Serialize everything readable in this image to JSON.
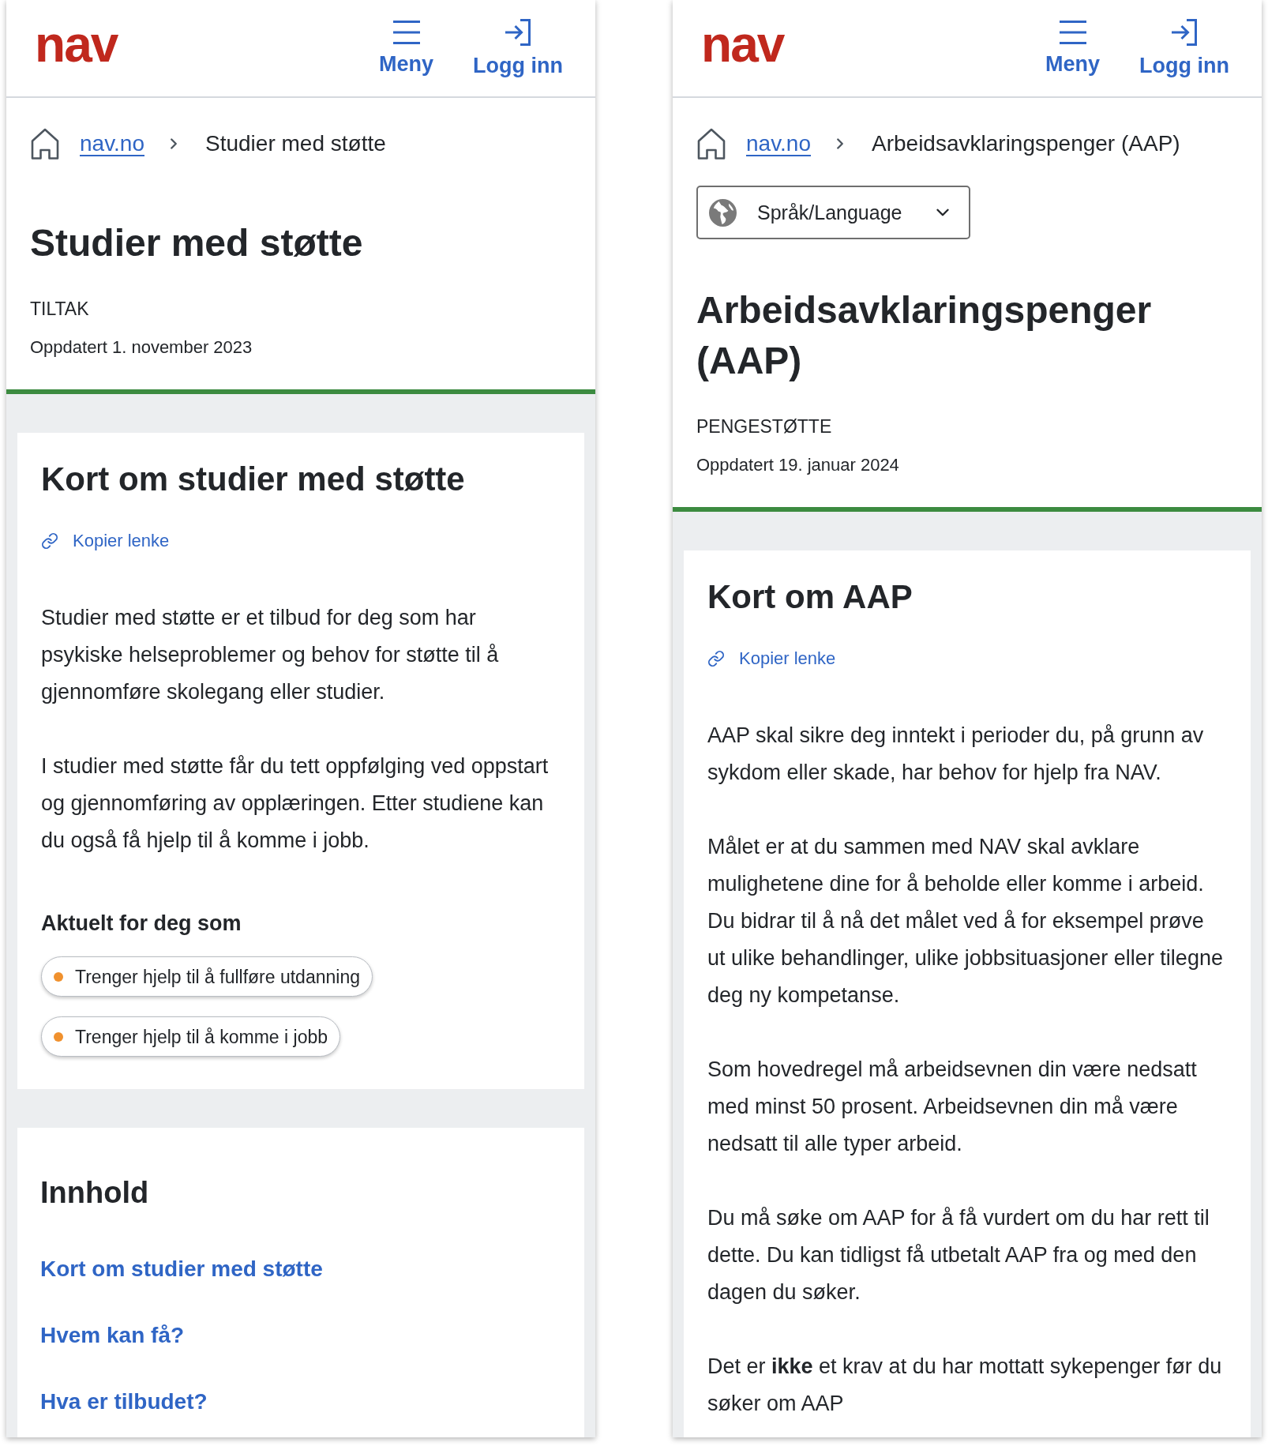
{
  "panels": [
    {
      "header": {
        "logo": "nav",
        "actions": [
          {
            "kind": "menu",
            "label": "Meny"
          },
          {
            "kind": "login",
            "label": "Logg inn"
          }
        ]
      },
      "breadcrumb": {
        "home": "nav.no",
        "current": "Studier med støtte"
      },
      "title": "Studier med støtte",
      "category": "TILTAK",
      "updated": "Oppdatert 1. november 2023",
      "sections": [
        {
          "kind": "summary",
          "heading": "Kort om studier med støtte",
          "copy_link": "Kopier lenke",
          "paragraphs": [
            "Studier med støtte er et tilbud for deg som har psykiske helseproblemer og behov for støtte til å gjennomføre skolegang eller studier.",
            "I studier med støtte får du tett oppfølging ved oppstart og gjennomføring av opplæringen. Etter studiene kan du også få hjelp til å komme i jobb."
          ],
          "tags_heading": "Aktuelt for deg som",
          "tags": [
            "Trenger hjelp til å fullføre utdanning",
            "Trenger hjelp til å komme i jobb"
          ]
        },
        {
          "kind": "contents",
          "heading": "Innhold",
          "links": [
            "Kort om studier med støtte",
            "Hvem kan få?",
            "Hva er tilbudet?"
          ]
        }
      ]
    },
    {
      "header": {
        "logo": "nav",
        "actions": [
          {
            "kind": "menu",
            "label": "Meny"
          },
          {
            "kind": "login",
            "label": "Logg inn"
          }
        ]
      },
      "breadcrumb": {
        "home": "nav.no",
        "current": "Arbeidsavklaringspenger (AAP)"
      },
      "language_selector": {
        "label": "Språk/Language"
      },
      "title": "Arbeidsavklaringspenger (AAP)",
      "category": "PENGESTØTTE",
      "updated": "Oppdatert 19. januar 2024",
      "sections": [
        {
          "kind": "summary",
          "heading": "Kort om AAP",
          "copy_link": "Kopier lenke",
          "paragraphs": [
            "AAP skal sikre deg inntekt i perioder du, på grunn av sykdom eller skade, har behov for hjelp fra NAV.",
            "Målet er at du sammen med NAV skal avklare mulighetene dine for å beholde eller komme i arbeid. Du bidrar til å nå det målet ved å for eksempel prøve ut ulike behandlinger, ulike jobbsituasjoner eller tilegne deg ny kompetanse.",
            "Som hovedregel må arbeidsevnen din være nedsatt med minst 50 prosent. Arbeidsevnen din må være nedsatt til alle typer arbeid.",
            "Du må søke om AAP for å få vurdert om du har rett til dette. Du kan tidligst få utbetalt AAP fra og med den dagen du søker.",
            "Det er **ikke** et krav at du har mottatt sykepenger før du søker om AAP"
          ]
        }
      ]
    }
  ]
}
